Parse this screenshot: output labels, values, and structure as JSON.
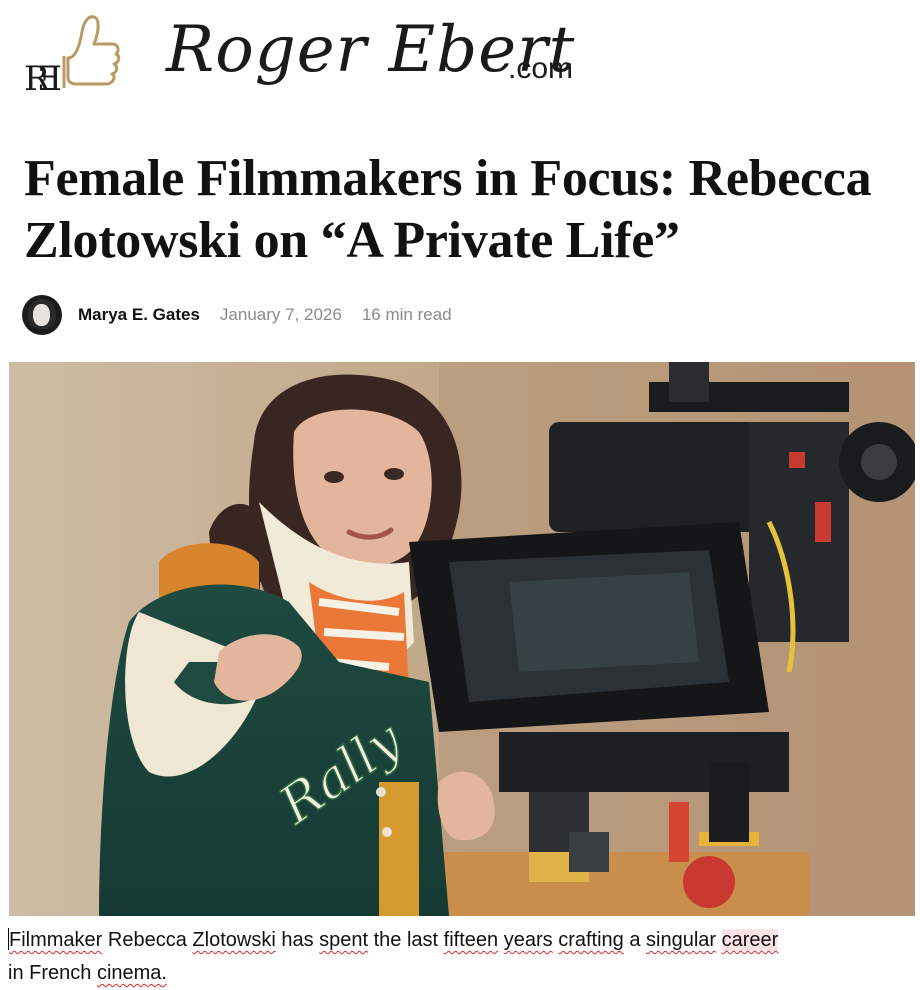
{
  "site": {
    "logo_text": "Roger Ebert",
    "logo_tld": ".com",
    "logo_mark": "thumbs-up-icon"
  },
  "article": {
    "headline": "Female Filmmakers in Focus: Rebecca Zlotowski on “A Private Life”",
    "author": "Marya E. Gates",
    "date": "January 7, 2026",
    "read_time": "16 min read"
  },
  "hero_image": {
    "description_name": "director-with-film-camera-photo",
    "jacket_lettering": "Rally"
  },
  "caption": {
    "w1": "Filmmaker",
    "w2": " Rebecca ",
    "w3": "Zlotowski",
    "w4": " has ",
    "w5": "spent",
    "w6": " the last ",
    "w7": "fifteen",
    "w8": " ",
    "w9": "years",
    "w10": " ",
    "w11": "crafting",
    "w12": " a ",
    "w13": "singular",
    "w14": " ",
    "w15": "career",
    "w16": "in French ",
    "w17": "cinema",
    "w18": "."
  },
  "colors": {
    "spell_underline": "#d62a2a",
    "highlight": "#fbe3e6",
    "meta_gray": "#8a8a8a"
  }
}
